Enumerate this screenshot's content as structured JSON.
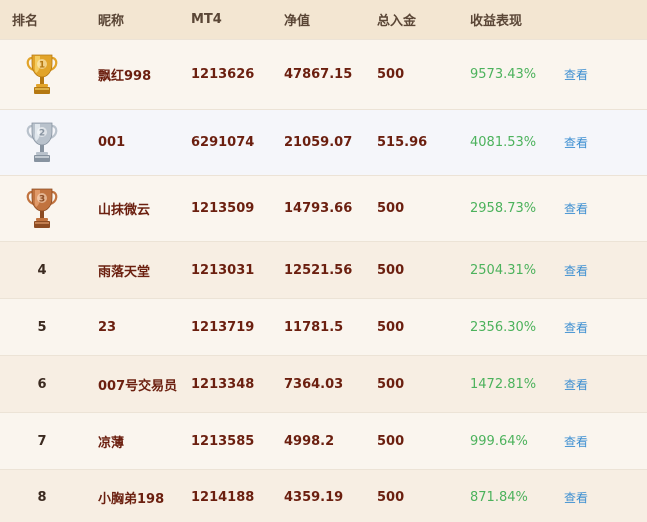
{
  "header": {
    "rank": "排名",
    "nickname": "昵称",
    "mt4": "MT4",
    "equity": "净值",
    "deposit": "总入金",
    "return": "收益表现"
  },
  "rows": [
    {
      "rank": "1",
      "trophy": "gold-trophy-icon",
      "nickname": "飘红998",
      "mt4": "1213626",
      "equity": "47867.15",
      "deposit": "500",
      "return": "9573.43%",
      "action": "查看",
      "bg": "#faf5ee"
    },
    {
      "rank": "2",
      "trophy": "silver-trophy-icon",
      "nickname": "001",
      "mt4": "6291074",
      "equity": "21059.07",
      "deposit": "515.96",
      "return": "4081.53%",
      "action": "查看",
      "bg": "#f5f6fa"
    },
    {
      "rank": "3",
      "trophy": "bronze-trophy-icon",
      "nickname": "山抹微云",
      "mt4": "1213509",
      "equity": "14793.66",
      "deposit": "500",
      "return": "2958.73%",
      "action": "查看",
      "bg": "#faf5ee"
    },
    {
      "rank": "4",
      "nickname": "雨落天堂",
      "mt4": "1213031",
      "equity": "12521.56",
      "deposit": "500",
      "return": "2504.31%",
      "action": "查看",
      "bg": "#f7eee3"
    },
    {
      "rank": "5",
      "nickname": "23",
      "mt4": "1213719",
      "equity": "11781.5",
      "deposit": "500",
      "return": "2356.30%",
      "action": "查看",
      "bg": "#faf5ee"
    },
    {
      "rank": "6",
      "nickname": "007号交易员",
      "mt4": "1213348",
      "equity": "7364.03",
      "deposit": "500",
      "return": "1472.81%",
      "action": "查看",
      "bg": "#f7eee3"
    },
    {
      "rank": "7",
      "nickname": "凉薄",
      "mt4": "1213585",
      "equity": "4998.2",
      "deposit": "500",
      "return": "999.64%",
      "action": "查看",
      "bg": "#faf5ee"
    },
    {
      "rank": "8",
      "nickname": "小胸弟198",
      "mt4": "1214188",
      "equity": "4359.19",
      "deposit": "500",
      "return": "871.84%",
      "action": "查看",
      "bg": "#f7eee3"
    }
  ],
  "colors": {
    "gold": "#e9b43a",
    "silver": "#b9c2cc",
    "bronze": "#c1733f",
    "return_green": "#4cb25c",
    "link_blue": "#3d8fd1"
  }
}
